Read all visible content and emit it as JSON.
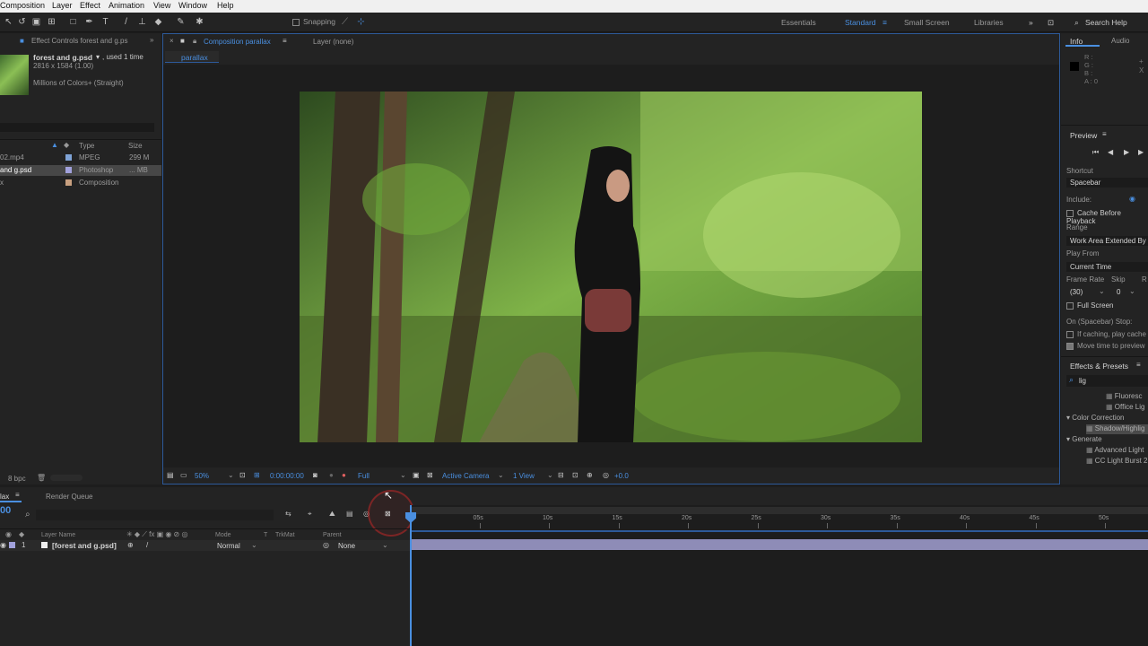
{
  "menubar": {
    "items": [
      "Composition",
      "Layer",
      "Effect",
      "Animation",
      "View",
      "Window",
      "Help"
    ]
  },
  "toolbar": {
    "snapping": "Snapping",
    "workspaces": [
      "Essentials",
      "Standard",
      "Small Screen",
      "Libraries"
    ],
    "active_workspace": "Standard",
    "search_placeholder": "Search Help"
  },
  "project": {
    "tab": "Effect Controls forest and g.ps",
    "item_name": "forest and g.psd",
    "used": ", used 1 time",
    "dimensions": "2816 x 1584 (1.00)",
    "colors": "Millions of Colors+ (Straight)",
    "columns": {
      "type": "Type",
      "size": "Size"
    },
    "rows": [
      {
        "name": "02.mp4",
        "type": "MPEG",
        "size": "299 M",
        "color": "#7fa3d6"
      },
      {
        "name": "and g.psd",
        "type": "Photoshop",
        "size": "... MB",
        "color": "#a1a1dc"
      },
      {
        "name": "x",
        "type": "Composition",
        "size": "",
        "color": "#c8a080"
      }
    ],
    "bpc": "8 bpc"
  },
  "composition": {
    "tab": "Composition parallax",
    "layer_tab": "Layer (none)",
    "breadcrumb": "parallax",
    "zoom": "50%",
    "timecode": "0:00:00:00",
    "resolution": "Full",
    "camera": "Active Camera",
    "views": "1 View",
    "exposure": "+0.0"
  },
  "info": {
    "tabs": [
      "Info",
      "Audio"
    ],
    "channels": [
      "R :",
      "G :",
      "B :",
      "A : 0"
    ]
  },
  "preview": {
    "title": "Preview",
    "shortcut_label": "Shortcut",
    "shortcut": "Spacebar",
    "include": "Include:",
    "cache": "Cache Before Playback",
    "range_label": "Range",
    "range": "Work Area Extended By",
    "play_from_label": "Play From",
    "play_from": "Current Time",
    "frame_rate": "Frame Rate",
    "skip": "Skip",
    "res": "R",
    "fps": "(30)",
    "skip_val": "0",
    "full_screen": "Full Screen",
    "stop_label": "On (Spacebar) Stop:",
    "if_caching": "If caching, play cache",
    "move_time": "Move time to preview"
  },
  "effects": {
    "title": "Effects & Presets",
    "search": "lig",
    "items": [
      {
        "label": "Fluoresc",
        "indent": 2
      },
      {
        "label": "Office Lig",
        "indent": 2
      },
      {
        "label": "Color Correction",
        "indent": 0,
        "folder": true
      },
      {
        "label": "Shadow/Highlig",
        "indent": 1,
        "selected": true
      },
      {
        "label": "Generate",
        "indent": 0,
        "folder": true
      },
      {
        "label": "Advanced Light",
        "indent": 1
      },
      {
        "label": "CC Light Burst 2",
        "indent": 1
      }
    ]
  },
  "timeline": {
    "tabs": [
      "lax",
      "Render Queue"
    ],
    "timecode": "00",
    "columns": {
      "layer_name": "Layer Name",
      "mode": "Mode",
      "t": "T",
      "trkmat": "TrkMat",
      "parent": "Parent"
    },
    "layer": {
      "num": "1",
      "name": "[forest and g.psd]",
      "mode": "Normal",
      "parent": "None"
    },
    "ruler": [
      "05s",
      "10s",
      "15s",
      "20s",
      "25s",
      "30s",
      "35s",
      "40s",
      "45s",
      "50s"
    ]
  },
  "colors": {
    "accent": "#4a8fe0",
    "panel": "#232323",
    "bg": "#1d1d1d"
  }
}
